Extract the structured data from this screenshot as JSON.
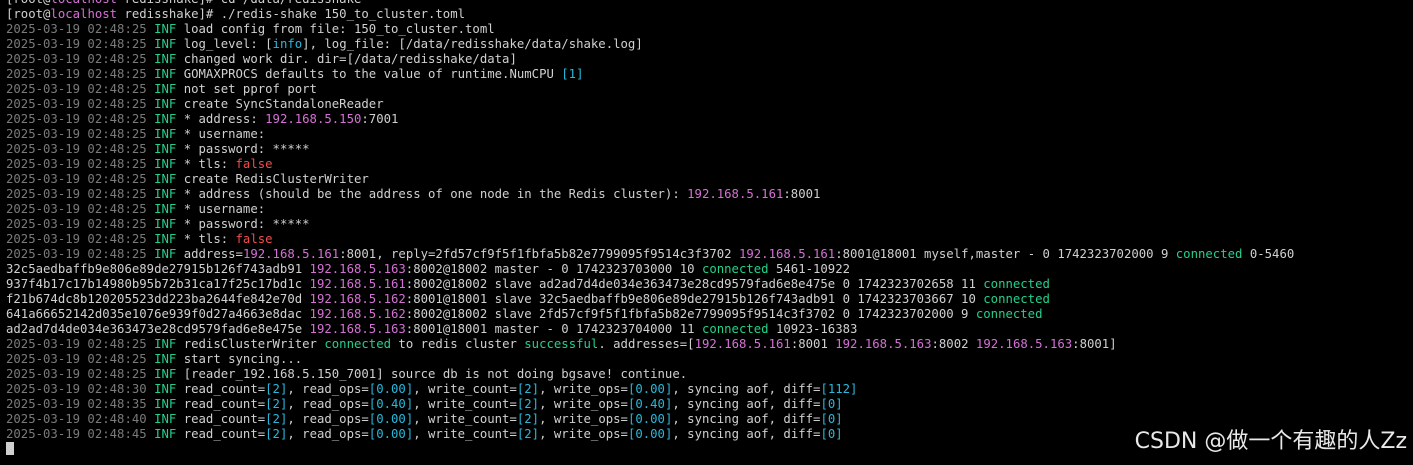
{
  "terminal": {
    "lines": [
      [
        [
          "c-text",
          "[root@"
        ],
        [
          "c-host",
          "localhost"
        ],
        [
          "c-text",
          " redisshake]# cd /data/redisshake"
        ]
      ],
      [
        [
          "c-text",
          "[root@"
        ],
        [
          "c-host",
          "localhost"
        ],
        [
          "c-text",
          " redisshake]# ./redis-shake 150_to_cluster.toml"
        ]
      ],
      [
        [
          "c-time",
          "2025-03-19 02:48:25 "
        ],
        [
          "c-inf",
          "INF "
        ],
        [
          "c-text",
          "load config from file: 150_to_cluster.toml"
        ]
      ],
      [
        [
          "c-time",
          "2025-03-19 02:48:25 "
        ],
        [
          "c-inf",
          "INF "
        ],
        [
          "c-text",
          "log_level: ["
        ],
        [
          "c-num",
          "info"
        ],
        [
          "c-text",
          "], log_file: [/data/redisshake/data/shake.log]"
        ]
      ],
      [
        [
          "c-time",
          "2025-03-19 02:48:25 "
        ],
        [
          "c-inf",
          "INF "
        ],
        [
          "c-text",
          "changed work dir. dir=[/data/redisshake/data]"
        ]
      ],
      [
        [
          "c-time",
          "2025-03-19 02:48:25 "
        ],
        [
          "c-inf",
          "INF "
        ],
        [
          "c-text",
          "GOMAXPROCS defaults to the value of runtime.NumCPU "
        ],
        [
          "c-num",
          "[1]"
        ]
      ],
      [
        [
          "c-time",
          "2025-03-19 02:48:25 "
        ],
        [
          "c-inf",
          "INF "
        ],
        [
          "c-text",
          "not set pprof port"
        ]
      ],
      [
        [
          "c-time",
          "2025-03-19 02:48:25 "
        ],
        [
          "c-inf",
          "INF "
        ],
        [
          "c-text",
          "create SyncStandaloneReader"
        ]
      ],
      [
        [
          "c-time",
          "2025-03-19 02:48:25 "
        ],
        [
          "c-inf",
          "INF "
        ],
        [
          "c-text",
          "* address: "
        ],
        [
          "c-ip",
          "192.168.5.150"
        ],
        [
          "c-text",
          ":7001"
        ]
      ],
      [
        [
          "c-time",
          "2025-03-19 02:48:25 "
        ],
        [
          "c-inf",
          "INF "
        ],
        [
          "c-text",
          "* username:"
        ]
      ],
      [
        [
          "c-time",
          "2025-03-19 02:48:25 "
        ],
        [
          "c-inf",
          "INF "
        ],
        [
          "c-text",
          "* password: *****"
        ]
      ],
      [
        [
          "c-time",
          "2025-03-19 02:48:25 "
        ],
        [
          "c-inf",
          "INF "
        ],
        [
          "c-text",
          "* tls: "
        ],
        [
          "c-red",
          "false"
        ]
      ],
      [
        [
          "c-time",
          "2025-03-19 02:48:25 "
        ],
        [
          "c-inf",
          "INF "
        ],
        [
          "c-text",
          "create RedisClusterWriter"
        ]
      ],
      [
        [
          "c-time",
          "2025-03-19 02:48:25 "
        ],
        [
          "c-inf",
          "INF "
        ],
        [
          "c-text",
          "* address (should be the address of one node in the Redis cluster): "
        ],
        [
          "c-ip",
          "192.168.5.161"
        ],
        [
          "c-text",
          ":8001"
        ]
      ],
      [
        [
          "c-time",
          "2025-03-19 02:48:25 "
        ],
        [
          "c-inf",
          "INF "
        ],
        [
          "c-text",
          "* username:"
        ]
      ],
      [
        [
          "c-time",
          "2025-03-19 02:48:25 "
        ],
        [
          "c-inf",
          "INF "
        ],
        [
          "c-text",
          "* password: *****"
        ]
      ],
      [
        [
          "c-time",
          "2025-03-19 02:48:25 "
        ],
        [
          "c-inf",
          "INF "
        ],
        [
          "c-text",
          "* tls: "
        ],
        [
          "c-red",
          "false"
        ]
      ],
      [
        [
          "c-time",
          "2025-03-19 02:48:25 "
        ],
        [
          "c-inf",
          "INF "
        ],
        [
          "c-text",
          "address="
        ],
        [
          "c-ip",
          "192.168.5.161"
        ],
        [
          "c-text",
          ":8001, reply=2fd57cf9f5f1fbfa5b82e7799095f9514c3f3702 "
        ],
        [
          "c-ip",
          "192.168.5.161"
        ],
        [
          "c-text",
          ":8001@18001 myself,master - 0 1742323702000 9 "
        ],
        [
          "c-green",
          "connected"
        ],
        [
          "c-text",
          " 0-5460"
        ]
      ],
      [
        [
          "c-text",
          "32c5aedbaffb9e806e89de27915b126f743adb91 "
        ],
        [
          "c-ip",
          "192.168.5.163"
        ],
        [
          "c-text",
          ":8002@18002 master - 0 1742323703000 10 "
        ],
        [
          "c-green",
          "connected"
        ],
        [
          "c-text",
          " 5461-10922"
        ]
      ],
      [
        [
          "c-text",
          "937f4b17c17b14980b95b72b31ca17f25c17bd1c "
        ],
        [
          "c-ip",
          "192.168.5.161"
        ],
        [
          "c-text",
          ":8002@18002 slave ad2ad7d4de034e363473e28cd9579fad6e8e475e 0 1742323702658 11 "
        ],
        [
          "c-green",
          "connected"
        ]
      ],
      [
        [
          "c-text",
          "f21b674dc8b120205523dd223ba2644fe842e70d "
        ],
        [
          "c-ip",
          "192.168.5.162"
        ],
        [
          "c-text",
          ":8001@18001 slave 32c5aedbaffb9e806e89de27915b126f743adb91 0 1742323703667 10 "
        ],
        [
          "c-green",
          "connected"
        ]
      ],
      [
        [
          "c-text",
          "641a66652142d035e1076e939f0d27a4663e8dac "
        ],
        [
          "c-ip",
          "192.168.5.162"
        ],
        [
          "c-text",
          ":8002@18002 slave 2fd57cf9f5f1fbfa5b82e7799095f9514c3f3702 0 1742323702000 9 "
        ],
        [
          "c-green",
          "connected"
        ]
      ],
      [
        [
          "c-text",
          "ad2ad7d4de034e363473e28cd9579fad6e8e475e "
        ],
        [
          "c-ip",
          "192.168.5.163"
        ],
        [
          "c-text",
          ":8001@18001 master - 0 1742323704000 11 "
        ],
        [
          "c-green",
          "connected"
        ],
        [
          "c-text",
          " 10923-16383"
        ]
      ],
      [
        [
          "c-time",
          "2025-03-19 02:48:25 "
        ],
        [
          "c-inf",
          "INF "
        ],
        [
          "c-text",
          "redisClusterWriter "
        ],
        [
          "c-green",
          "connected"
        ],
        [
          "c-text",
          " to redis cluster "
        ],
        [
          "c-green",
          "successful"
        ],
        [
          "c-text",
          ". addresses=["
        ],
        [
          "c-ip",
          "192.168.5.161"
        ],
        [
          "c-text",
          ":8001 "
        ],
        [
          "c-ip",
          "192.168.5.163"
        ],
        [
          "c-text",
          ":8002 "
        ],
        [
          "c-ip",
          "192.168.5.163"
        ],
        [
          "c-text",
          ":8001]"
        ]
      ],
      [
        [
          "c-time",
          "2025-03-19 02:48:25 "
        ],
        [
          "c-inf",
          "INF "
        ],
        [
          "c-text",
          "start syncing..."
        ]
      ],
      [
        [
          "c-time",
          "2025-03-19 02:48:25 "
        ],
        [
          "c-inf",
          "INF "
        ],
        [
          "c-text",
          "[reader_192.168.5.150_7001] source db is not doing bgsave! continue."
        ]
      ],
      [
        [
          "c-time",
          "2025-03-19 02:48:30 "
        ],
        [
          "c-inf",
          "INF "
        ],
        [
          "c-text",
          "read_count="
        ],
        [
          "c-num",
          "[2]"
        ],
        [
          "c-text",
          ", read_ops="
        ],
        [
          "c-num",
          "[0.00]"
        ],
        [
          "c-text",
          ", write_count="
        ],
        [
          "c-num",
          "[2]"
        ],
        [
          "c-text",
          ", write_ops="
        ],
        [
          "c-num",
          "[0.00]"
        ],
        [
          "c-text",
          ", syncing aof, diff="
        ],
        [
          "c-num",
          "[112]"
        ]
      ],
      [
        [
          "c-time",
          "2025-03-19 02:48:35 "
        ],
        [
          "c-inf",
          "INF "
        ],
        [
          "c-text",
          "read_count="
        ],
        [
          "c-num",
          "[2]"
        ],
        [
          "c-text",
          ", read_ops="
        ],
        [
          "c-num",
          "[0.40]"
        ],
        [
          "c-text",
          ", write_count="
        ],
        [
          "c-num",
          "[2]"
        ],
        [
          "c-text",
          ", write_ops="
        ],
        [
          "c-num",
          "[0.40]"
        ],
        [
          "c-text",
          ", syncing aof, diff="
        ],
        [
          "c-num",
          "[0]"
        ]
      ],
      [
        [
          "c-time",
          "2025-03-19 02:48:40 "
        ],
        [
          "c-inf",
          "INF "
        ],
        [
          "c-text",
          "read_count="
        ],
        [
          "c-num",
          "[2]"
        ],
        [
          "c-text",
          ", read_ops="
        ],
        [
          "c-num",
          "[0.00]"
        ],
        [
          "c-text",
          ", write_count="
        ],
        [
          "c-num",
          "[2]"
        ],
        [
          "c-text",
          ", write_ops="
        ],
        [
          "c-num",
          "[0.00]"
        ],
        [
          "c-text",
          ", syncing aof, diff="
        ],
        [
          "c-num",
          "[0]"
        ]
      ],
      [
        [
          "c-time",
          "2025-03-19 02:48:45 "
        ],
        [
          "c-inf",
          "INF "
        ],
        [
          "c-text",
          "read_count="
        ],
        [
          "c-num",
          "[2]"
        ],
        [
          "c-text",
          ", read_ops="
        ],
        [
          "c-num",
          "[0.00]"
        ],
        [
          "c-text",
          ", write_count="
        ],
        [
          "c-num",
          "[2]"
        ],
        [
          "c-text",
          ", write_ops="
        ],
        [
          "c-num",
          "[0.00]"
        ],
        [
          "c-text",
          ", syncing aof, diff="
        ],
        [
          "c-num",
          "[0]"
        ]
      ]
    ]
  },
  "watermark": "CSDN @做一个有趣的人Zz",
  "colors": {
    "background": "#000000",
    "text": "#d0d0d0",
    "timestamp": "#7a7a7a",
    "inf": "#23d18b",
    "ip": "#d670d6",
    "number": "#29b8db",
    "false": "#f14c4c"
  }
}
